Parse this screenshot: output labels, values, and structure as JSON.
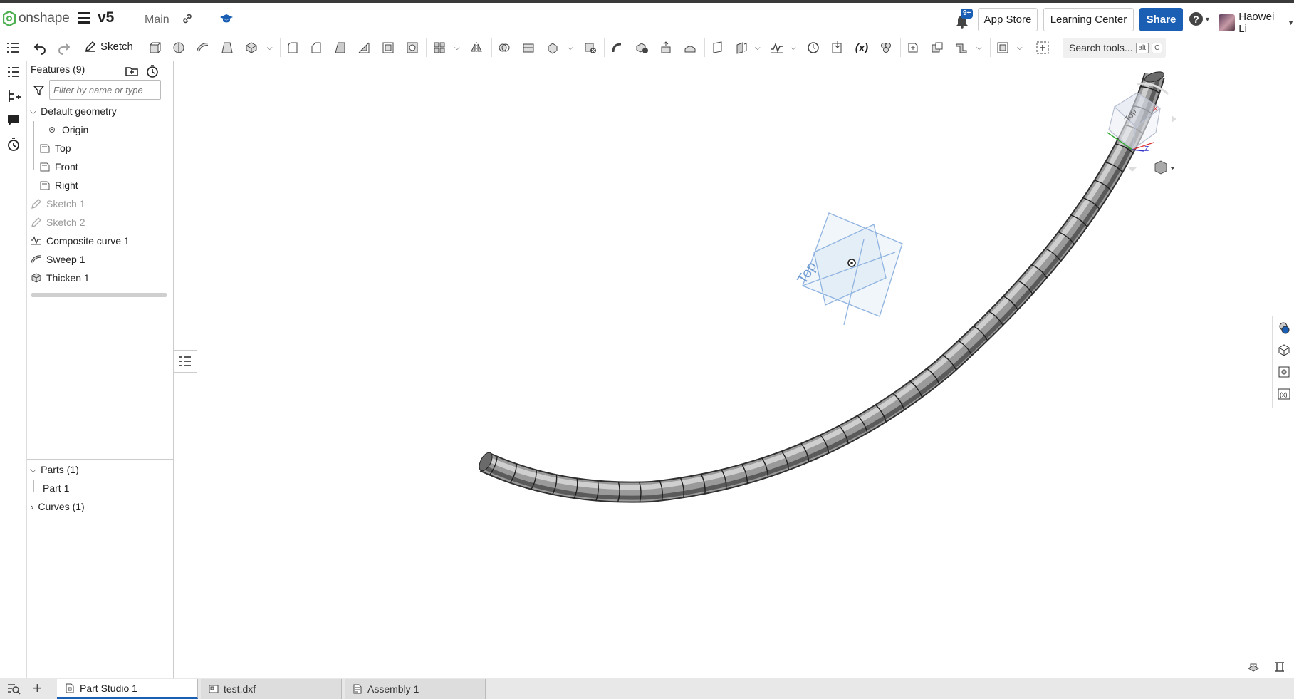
{
  "header": {
    "logo_text": "onshape",
    "document_name": "v5",
    "branch": "Main",
    "notification_badge": "9+",
    "app_store_label": "App Store",
    "learning_center_label": "Learning Center",
    "share_label": "Share",
    "help_label": "?",
    "user_name": "Haowei Li"
  },
  "toolbar": {
    "sketch_label": "Sketch",
    "variable_label": "(x)",
    "search_placeholder": "Search tools...",
    "shortcut_keys": [
      "alt",
      "C"
    ]
  },
  "feature_panel": {
    "title": "Features (9)",
    "filter_placeholder": "Filter by name or type",
    "default_geometry_label": "Default geometry",
    "default_geometry_items": [
      "Origin",
      "Top",
      "Front",
      "Right"
    ],
    "features": [
      {
        "label": "Sketch 1",
        "icon": "sketch-icon",
        "suppressed": true
      },
      {
        "label": "Sketch 2",
        "icon": "sketch-icon",
        "suppressed": true
      },
      {
        "label": "Composite curve 1",
        "icon": "composite-curve-icon",
        "suppressed": false
      },
      {
        "label": "Sweep 1",
        "icon": "sweep-icon",
        "suppressed": false
      },
      {
        "label": "Thicken 1",
        "icon": "thicken-icon",
        "suppressed": false
      }
    ],
    "parts_label": "Parts (1)",
    "parts": [
      "Part 1"
    ],
    "curves_label": "Curves (1)"
  },
  "viewport": {
    "plane_label": "Top",
    "view_cube_label": "Top",
    "axis_x": "X",
    "axis_z": "Z",
    "model_color": "#7d7d7d",
    "plane_color": "#8fb3e0"
  },
  "tabs": [
    {
      "label": "Part Studio 1",
      "active": true,
      "icon": "part-studio-icon"
    },
    {
      "label": "test.dxf",
      "active": false,
      "icon": "drawing-icon"
    },
    {
      "label": "Assembly 1",
      "active": false,
      "icon": "assembly-icon"
    }
  ],
  "colors": {
    "accent": "#1a5fb4",
    "brand_green": "#4caf50"
  }
}
